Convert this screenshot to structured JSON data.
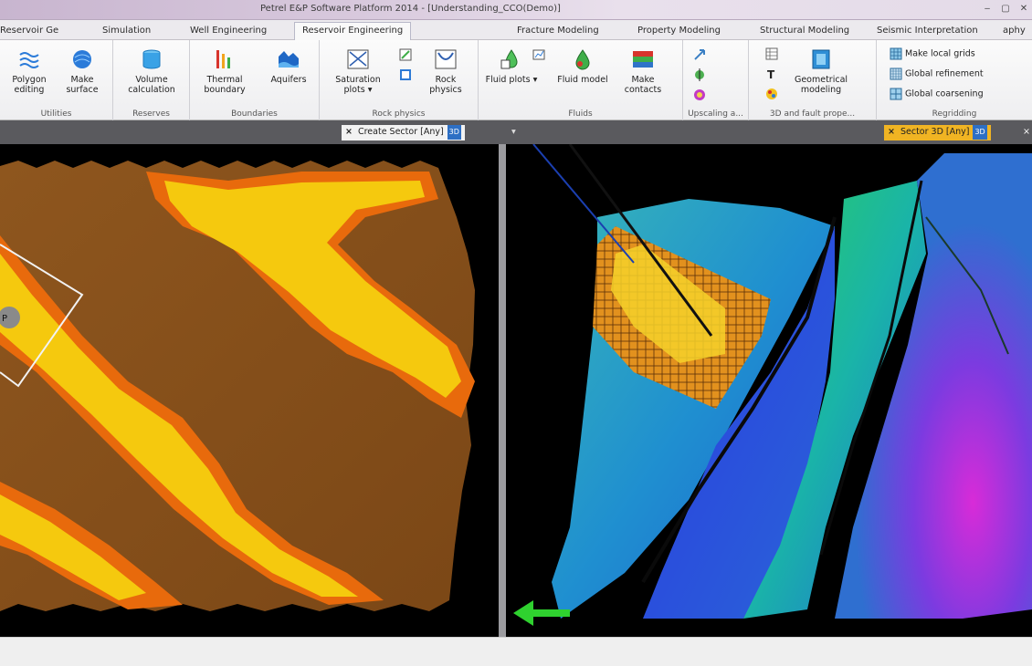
{
  "window": {
    "title": "Petrel E&P Software Platform 2014 - [Understanding_CCO(Demo)]"
  },
  "ribbon_tabs": [
    "aphy",
    "Seismic Interpretation",
    "Structural Modeling",
    "Property Modeling",
    "Fracture Modeling",
    "Reservoir Engineering",
    "Well Engineering",
    "Simulation",
    "Reservoir Ge"
  ],
  "active_tab": "Reservoir Engineering",
  "ribbon": {
    "regridding": {
      "label": "Regridding",
      "items": [
        "Make local grids",
        "Global refinement",
        "Global coarsening"
      ]
    },
    "geometrical_modeling": {
      "label": "Geometrical modeling",
      "group": "3D and fault prope..."
    },
    "upscaling": {
      "group": "Upscaling a..."
    },
    "fluids": {
      "label": "Fluids",
      "items": [
        "Make contacts",
        "Fluid model",
        "Fluid plots ▾"
      ]
    },
    "rock_physics": {
      "label": "Rock physics",
      "items": [
        "Rock physics",
        "Saturation plots ▾"
      ]
    },
    "boundaries": {
      "label": "Boundaries",
      "items": [
        "Aquifers",
        "Thermal boundary"
      ]
    },
    "reserves": {
      "label": "Reserves",
      "items": [
        "Volume calculation"
      ]
    },
    "utilities": {
      "label": "Utilities",
      "items": [
        "Make surface",
        "Polygon editing"
      ]
    }
  },
  "docs": {
    "left_tab": "Create Sector [Any]",
    "right_tab": "Sector 3D [Any]",
    "badge": "3D",
    "close": "×"
  },
  "viewport_left": {
    "marker_label": "P"
  }
}
